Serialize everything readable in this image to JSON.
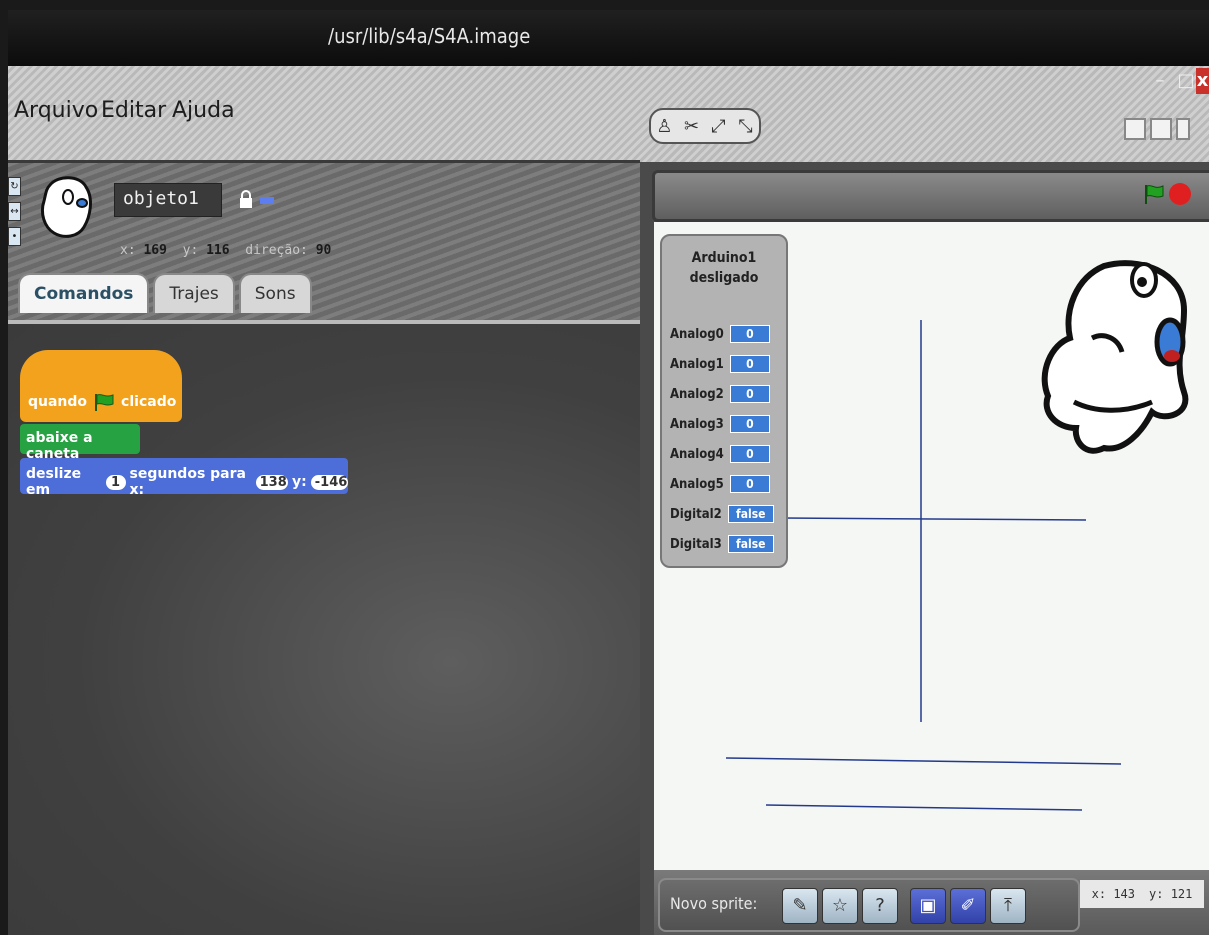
{
  "window": {
    "title": "/usr/lib/s4a/S4A.image",
    "minimize": "–",
    "maximize": "□",
    "close": "x"
  },
  "menu": {
    "items": [
      "Arquivo",
      "Editar",
      "Ajuda"
    ]
  },
  "sprite": {
    "name": "objeto1",
    "x_label": "x:",
    "x_value": "169",
    "y_label": "y:",
    "y_value": "116",
    "direction_label": "direção:",
    "direction_value": "90",
    "pen_color": "#5d7ef0"
  },
  "tabs": [
    {
      "label": "Comandos",
      "active": true
    },
    {
      "label": "Trajes",
      "active": false
    },
    {
      "label": "Sons",
      "active": false
    }
  ],
  "scripts": {
    "hat": {
      "text_before": "quando",
      "text_after": "clicado"
    },
    "pen": {
      "text": "abaixe a caneta"
    },
    "motion": {
      "text_1": "deslize em",
      "secs": "1",
      "text_2": "segundos para x:",
      "x": "138",
      "text_3": "y:",
      "y": "-146"
    }
  },
  "sensors": {
    "title_1": "Arduino1",
    "title_2": "desligado",
    "rows": [
      {
        "label": "Analog0",
        "value": "0"
      },
      {
        "label": "Analog1",
        "value": "0"
      },
      {
        "label": "Analog2",
        "value": "0"
      },
      {
        "label": "Analog3",
        "value": "0"
      },
      {
        "label": "Analog4",
        "value": "0"
      },
      {
        "label": "Analog5",
        "value": "0"
      },
      {
        "label": "Digital2",
        "value": "false"
      },
      {
        "label": "Digital3",
        "value": "false"
      }
    ]
  },
  "sprite_bar": {
    "label": "Novo sprite:"
  },
  "mouse": {
    "x_label": "x:",
    "x_value": "143",
    "y_label": "y:",
    "y_value": "121"
  },
  "colors": {
    "hat_block": "#f2a21c",
    "pen_block": "#26a243",
    "motion_block": "#4d6dd8",
    "sensor_value": "#3a7bd6",
    "stop": "#e02020",
    "go_flag": "#22a022",
    "pen_lines": "#233a8c"
  }
}
